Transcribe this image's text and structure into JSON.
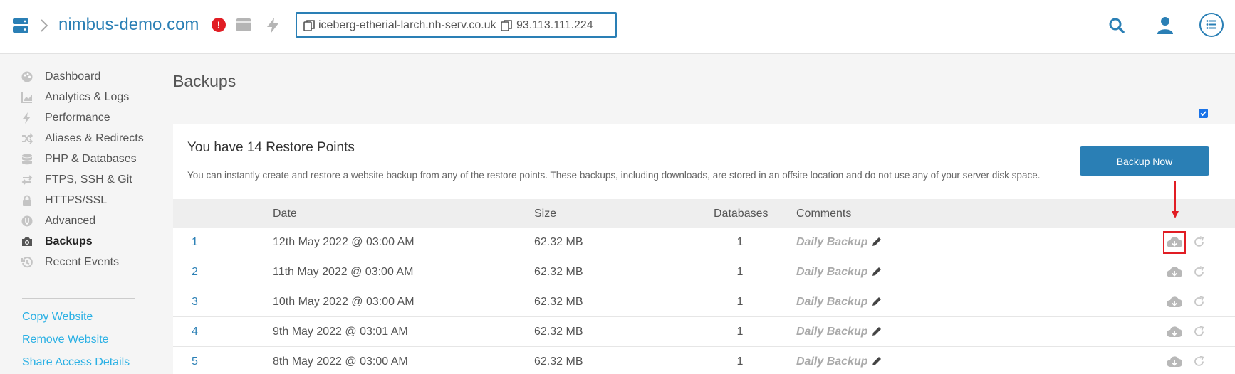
{
  "header": {
    "domain": "nimbus-demo.com",
    "alert_mark": "!",
    "hostname": "iceberg-etherial-larch.nh-serv.co.uk",
    "ip": "93.113.111.224"
  },
  "sidebar": {
    "items": [
      {
        "label": "Dashboard",
        "icon": "palette-icon"
      },
      {
        "label": "Analytics & Logs",
        "icon": "chart-icon"
      },
      {
        "label": "Performance",
        "icon": "bolt-icon"
      },
      {
        "label": "Aliases & Redirects",
        "icon": "shuffle-icon"
      },
      {
        "label": "PHP & Databases",
        "icon": "database-icon"
      },
      {
        "label": "FTPS, SSH & Git",
        "icon": "exchange-icon"
      },
      {
        "label": "HTTPS/SSL",
        "icon": "lock-icon"
      },
      {
        "label": "Advanced",
        "icon": "wrench-icon"
      },
      {
        "label": "Backups",
        "icon": "camera-icon",
        "active": true
      },
      {
        "label": "Recent Events",
        "icon": "history-icon"
      }
    ],
    "links": [
      "Copy Website",
      "Remove Website",
      "Share Access Details"
    ]
  },
  "main": {
    "title": "Backups",
    "panel_title": "You have 14 Restore Points",
    "panel_desc": "You can instantly create and restore a website backup from any of the restore points. These backups, including downloads, are stored in an offsite location and do not use any of your server disk space.",
    "backup_button": "Backup Now"
  },
  "table": {
    "columns": [
      "Date",
      "Size",
      "Databases",
      "Comments"
    ],
    "rows": [
      {
        "num": "1",
        "date": "12th May 2022 @ 03:00 AM",
        "size": "62.32 MB",
        "databases": "1",
        "comment": "Daily Backup"
      },
      {
        "num": "2",
        "date": "11th May 2022 @ 03:00 AM",
        "size": "62.32 MB",
        "databases": "1",
        "comment": "Daily Backup"
      },
      {
        "num": "3",
        "date": "10th May 2022 @ 03:00 AM",
        "size": "62.32 MB",
        "databases": "1",
        "comment": "Daily Backup"
      },
      {
        "num": "4",
        "date": "9th May 2022 @ 03:01 AM",
        "size": "62.32 MB",
        "databases": "1",
        "comment": "Daily Backup"
      },
      {
        "num": "5",
        "date": "8th May 2022 @ 03:00 AM",
        "size": "62.32 MB",
        "databases": "1",
        "comment": "Daily Backup"
      }
    ]
  },
  "colors": {
    "accent": "#2a7fb5",
    "link": "#2ab0e4",
    "alert": "#e11d24"
  }
}
